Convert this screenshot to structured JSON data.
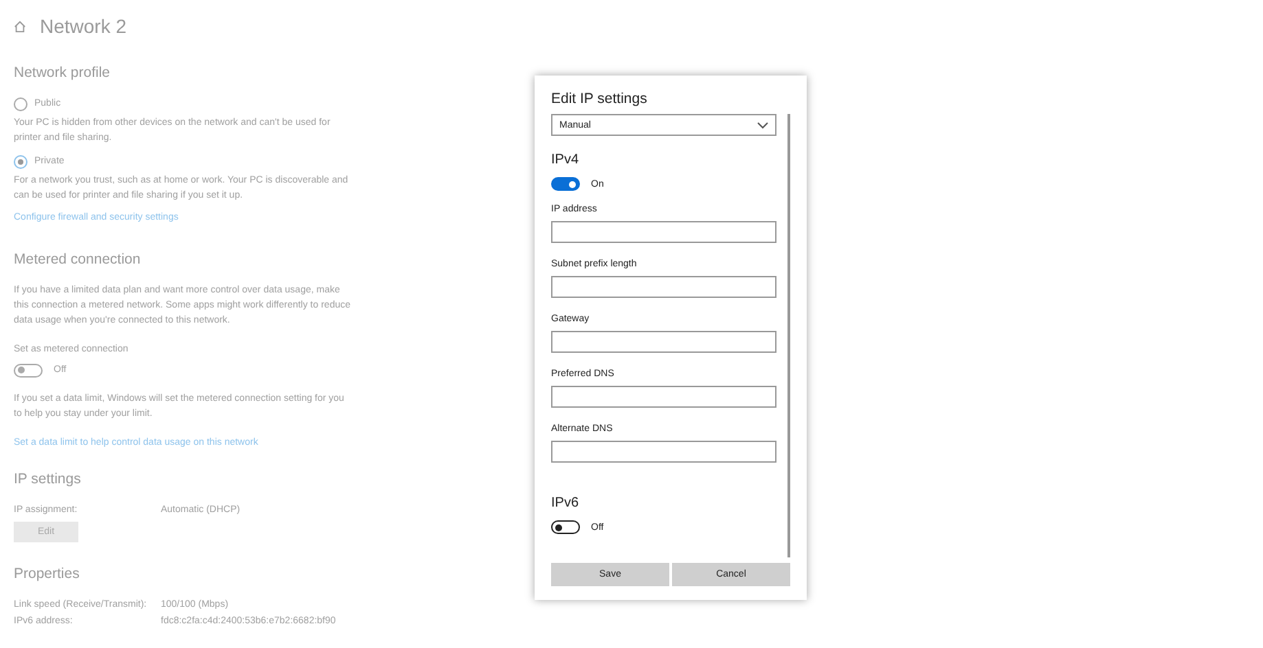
{
  "page": {
    "title": "Network 2"
  },
  "network_profile": {
    "heading": "Network profile",
    "options": [
      {
        "label": "Public",
        "selected": false,
        "description": "Your PC is hidden from other devices on the network and can't be used for printer and file sharing."
      },
      {
        "label": "Private",
        "selected": true,
        "description": "For a network you trust, such as at home or work. Your PC is discoverable and can be used for printer and file sharing if you set it up."
      }
    ],
    "link": "Configure firewall and security settings"
  },
  "metered_connection": {
    "heading": "Metered connection",
    "description": "If you have a limited data plan and want more control over data usage, make this connection a metered network. Some apps might work differently to reduce data usage when you're connected to this network.",
    "toggle_label": "Set as metered connection",
    "toggle": {
      "on": false,
      "state_text": "Off"
    },
    "note": "If you set a data limit, Windows will set the metered connection setting for you to help you stay under your limit.",
    "link": "Set a data limit to help control data usage on this network"
  },
  "ip_settings": {
    "heading": "IP settings",
    "rows": [
      {
        "label": "IP assignment:",
        "value": "Automatic (DHCP)"
      }
    ],
    "button": "Edit"
  },
  "properties": {
    "heading": "Properties",
    "rows": [
      {
        "label": "Link speed (Receive/Transmit):",
        "value": "100/100 (Mbps)"
      },
      {
        "label": "IPv6 address:",
        "value": "fdc8:c2fa:c4d:2400:53b6:e7b2:6682:bf90"
      }
    ]
  },
  "dialog": {
    "title": "Edit IP settings",
    "mode": "Manual",
    "ipv4": {
      "heading": "IPv4",
      "toggle": {
        "on": true,
        "state_text": "On"
      },
      "fields": [
        {
          "label": "IP address"
        },
        {
          "label": "Subnet prefix length"
        },
        {
          "label": "Gateway"
        },
        {
          "label": "Preferred DNS"
        },
        {
          "label": "Alternate DNS"
        }
      ]
    },
    "ipv6": {
      "heading": "IPv6",
      "toggle": {
        "on": false,
        "state_text": "Off"
      }
    },
    "buttons": [
      {
        "label": "Save"
      },
      {
        "label": "Cancel"
      }
    ]
  }
}
